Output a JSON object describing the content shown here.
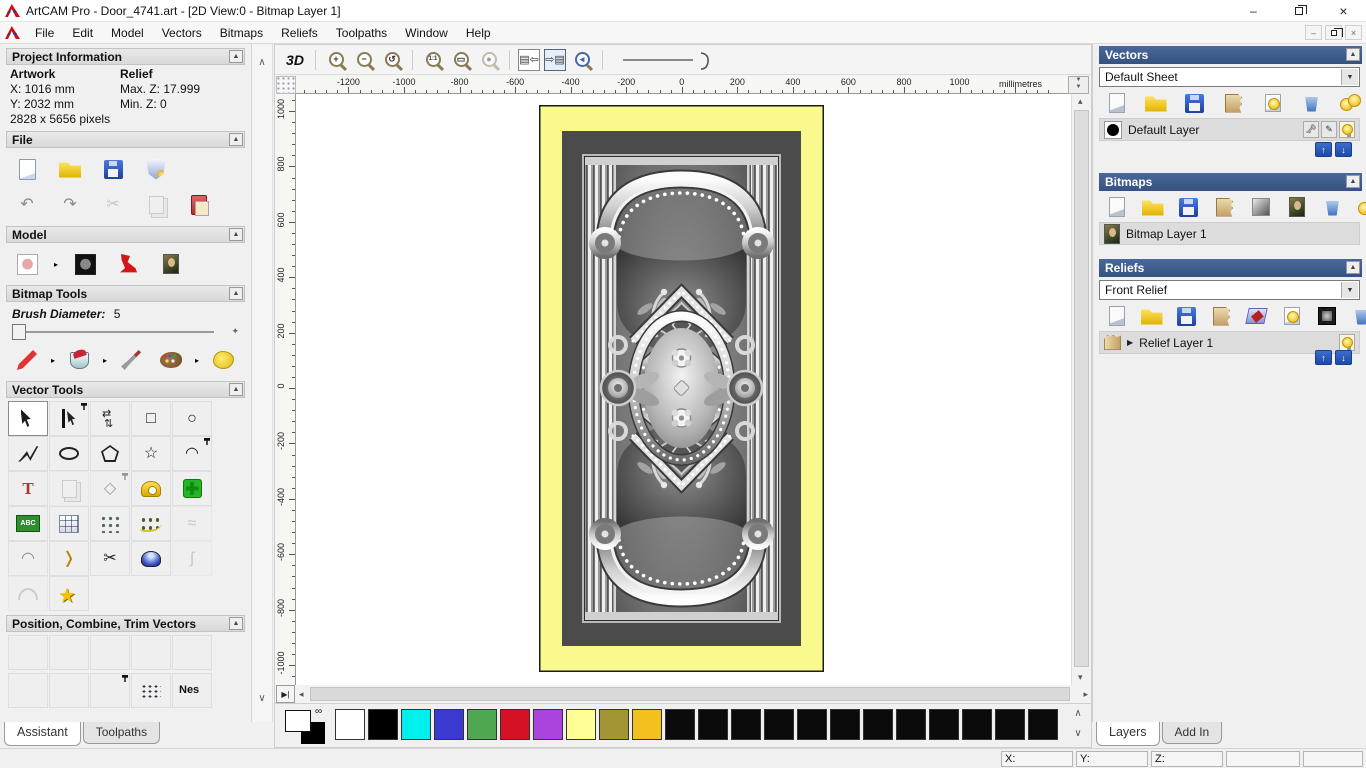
{
  "window": {
    "title": "ArtCAM Pro - Door_4741.art - [2D View:0 - Bitmap Layer 1]",
    "menus": [
      "File",
      "Edit",
      "Model",
      "Vectors",
      "Bitmaps",
      "Reliefs",
      "Toolpaths",
      "Window",
      "Help"
    ]
  },
  "assistant": {
    "project": {
      "title": "Project Information",
      "artwork_label": "Artwork",
      "relief_label": "Relief",
      "artwork_x": "X: 1016 mm",
      "artwork_y": "Y: 2032 mm",
      "relief_maxz": "Max. Z: 17.999",
      "relief_minz": "Min. Z: 0",
      "pixels": "2828 x 5656 pixels"
    },
    "file_title": "File",
    "file_icons1": [
      {
        "n": "new-model",
        "k": "page"
      },
      {
        "n": "open-model",
        "k": "folder"
      },
      {
        "n": "save-model",
        "k": "floppy"
      },
      {
        "n": "model-wizard",
        "k": "shield"
      }
    ],
    "file_icons2": [
      {
        "n": "undo",
        "g": "↶",
        "c": "c-gray"
      },
      {
        "n": "redo",
        "g": "↷",
        "c": "c-gray"
      },
      {
        "n": "cut",
        "g": "✂",
        "c": "c-gray",
        "d": true
      },
      {
        "n": "copy",
        "k": "copy",
        "d": true
      },
      {
        "n": "paste",
        "k": "clipboard"
      }
    ],
    "model_title": "Model",
    "model_icons": [
      {
        "n": "greyscale-from-model",
        "k": "bear",
        "fly": true
      },
      {
        "n": "model-from-greyscale",
        "k": "beardark"
      },
      {
        "n": "lighting-setup",
        "k": "lamp"
      },
      {
        "n": "load-texture",
        "k": "mona"
      }
    ],
    "bitmap_title": "Bitmap Tools",
    "brush_label": "Brush Diameter:",
    "brush_value": "5",
    "bitmap_icons": [
      {
        "n": "paint-brush",
        "k": "pencil",
        "fly": true
      },
      {
        "n": "flood-fill",
        "k": "bucket",
        "fly": true
      },
      {
        "n": "colour-picker",
        "k": "dropper"
      },
      {
        "n": "colour-palette",
        "k": "palette",
        "fly": true
      },
      {
        "n": "magic-sponge",
        "k": "sponge"
      }
    ],
    "vector_title": "Vector Tools",
    "vector_tools": [
      {
        "n": "select-vectors",
        "k": "cur",
        "p": true
      },
      {
        "n": "node-editing",
        "k": "node",
        "pin": true
      },
      {
        "n": "transform-vectors",
        "k": "trans"
      },
      {
        "n": "create-rectangle",
        "g": "□",
        "c": "c-dark"
      },
      {
        "n": "create-circle",
        "g": "○",
        "c": "c-dark"
      },
      {
        "n": "create-polyline",
        "k": "poly"
      },
      {
        "n": "create-ellipse",
        "k": "ell"
      },
      {
        "n": "create-polygon",
        "k": "pent"
      },
      {
        "n": "create-star",
        "g": "☆",
        "c": "c-dark"
      },
      {
        "n": "create-arc",
        "g": "◠",
        "c": "c-dark",
        "pin": true
      },
      {
        "n": "create-text",
        "k": "textT"
      },
      {
        "n": "weld-vectors",
        "k": "copy",
        "d": true
      },
      {
        "n": "offset-vectors",
        "g": "◇",
        "c": "c-dark",
        "d": true,
        "pin": true
      },
      {
        "n": "measure-tool",
        "k": "meas"
      },
      {
        "n": "vector-doctor",
        "k": "cross"
      },
      {
        "n": "text-on-curve",
        "k": "abc"
      },
      {
        "n": "envelope-distortion",
        "k": "grid"
      },
      {
        "n": "block-paste-array",
        "k": "dots"
      },
      {
        "n": "paste-along-curve",
        "k": "cdots"
      },
      {
        "n": "distort-vectors",
        "g": "≈",
        "c": "c-gray",
        "d": true
      },
      {
        "n": "fit-arcs-to-curve",
        "g": "◠",
        "c": "c-gray"
      },
      {
        "n": "create-bisector",
        "g": "❭",
        "c": "c-gold"
      },
      {
        "n": "trim-vectors",
        "g": "✂",
        "c": "c-dark"
      },
      {
        "n": "spin-vectors",
        "k": "revolve"
      },
      {
        "n": "free-form-curve",
        "g": "ʃ",
        "c": "c-gray",
        "d": true
      },
      {
        "n": "cross-section",
        "k": "section",
        "d": true
      },
      {
        "n": "star-wizard",
        "k": "star"
      }
    ],
    "position_title": "Position, Combine, Trim Vectors",
    "position_row1": [
      {
        "n": "align-left",
        "k": "al al-l"
      },
      {
        "n": "align-right",
        "k": "al al-r"
      },
      {
        "n": "align-top",
        "k": "al al-t"
      },
      {
        "n": "align-bottom",
        "k": "al al-b"
      },
      {
        "n": "align-centre-x",
        "k": "al al-cx"
      }
    ],
    "position_row2": [
      {
        "n": "align-centre-y",
        "k": "al al-cy"
      },
      {
        "n": "centre-in-page",
        "k": "al al-cp"
      },
      {
        "n": "paste-in-position",
        "k": "al al-pp",
        "pin": true
      },
      {
        "n": "scatter-copies",
        "k": "alsc"
      },
      {
        "n": "vector-nesting",
        "k": "nest"
      }
    ],
    "tabs": [
      {
        "label": "Assistant",
        "active": true
      },
      {
        "label": "Toolpaths",
        "active": false
      }
    ]
  },
  "canvas": {
    "toolbar_3d": "3D",
    "ruler_units": "millimetres",
    "h_labels": [
      "-1200",
      "-1000",
      "-800",
      "-600",
      "-400",
      "-200",
      "0",
      "200",
      "400",
      "600",
      "800",
      "1000"
    ],
    "v_labels": [
      "1000",
      "800",
      "600",
      "400",
      "200",
      "0",
      "-200",
      "-400",
      "-600",
      "-800",
      "-1000"
    ]
  },
  "palette": {
    "primary": "#ffffff",
    "secondary": "#000000",
    "colors": [
      "#ffffff",
      "#000000",
      "#00f0f0",
      "#3a3ad1",
      "#4fa84f",
      "#d41224",
      "#a944dd",
      "#ffff96",
      "#a39434",
      "#f3c11d",
      "#0a0a0a",
      "#0a0a0a",
      "#0a0a0a",
      "#0a0a0a",
      "#0a0a0a",
      "#0a0a0a",
      "#0a0a0a",
      "#0a0a0a",
      "#0a0a0a",
      "#0a0a0a",
      "#0a0a0a",
      "#0a0a0a"
    ]
  },
  "panels": {
    "vectors": {
      "title": "Vectors",
      "sheet": "Default Sheet",
      "toolbar": [
        {
          "n": "new-vector-sheet",
          "k": "pagegray"
        },
        {
          "n": "open-vectors",
          "k": "folder"
        },
        {
          "n": "save-vectors",
          "k": "floppy"
        },
        {
          "n": "merge-vector-layers",
          "k": "merge"
        },
        {
          "n": "toggle-layer-visibility",
          "k": "bulbpage"
        },
        {
          "n": "delete-vector-layer",
          "k": "trash"
        },
        {
          "n": "toggle-all-layers",
          "k": "bulbs"
        }
      ],
      "layer": "Default Layer"
    },
    "bitmaps": {
      "title": "Bitmaps",
      "toolbar": [
        {
          "n": "new-bitmap-layer",
          "k": "pagegray"
        },
        {
          "n": "open-bitmap",
          "k": "folder"
        },
        {
          "n": "save-bitmap",
          "k": "floppy"
        },
        {
          "n": "merge-bitmap-layers",
          "k": "merge"
        },
        {
          "n": "fade-bitmap",
          "k": "fade"
        },
        {
          "n": "bitmap-properties",
          "k": "mona"
        },
        {
          "n": "delete-bitmap-layer",
          "k": "trash"
        },
        {
          "n": "toggle-all-bitmaps",
          "k": "bulbs"
        }
      ],
      "layer": "Bitmap Layer 1"
    },
    "reliefs": {
      "title": "Reliefs",
      "combo": "Front Relief",
      "toolbar": [
        {
          "n": "new-relief-layer",
          "k": "pagegray"
        },
        {
          "n": "open-relief",
          "k": "folder"
        },
        {
          "n": "save-relief",
          "k": "floppy"
        },
        {
          "n": "merge-relief-layers",
          "k": "merge"
        },
        {
          "n": "stack-reliefs",
          "k": "stack"
        },
        {
          "n": "toggle-relief-visibility",
          "k": "bulbpage"
        },
        {
          "n": "relief-greyscale-view",
          "k": "film"
        },
        {
          "n": "delete-relief-layer",
          "k": "trash"
        },
        {
          "n": "toggle-all-reliefs",
          "k": "bulbs"
        }
      ],
      "layer": "Relief Layer 1"
    },
    "tabs": [
      {
        "label": "Layers",
        "active": true
      },
      {
        "label": "Add In",
        "active": false
      }
    ]
  },
  "statusbar": {
    "fields": [
      "X:",
      "Y:",
      "Z:",
      "",
      ""
    ]
  }
}
